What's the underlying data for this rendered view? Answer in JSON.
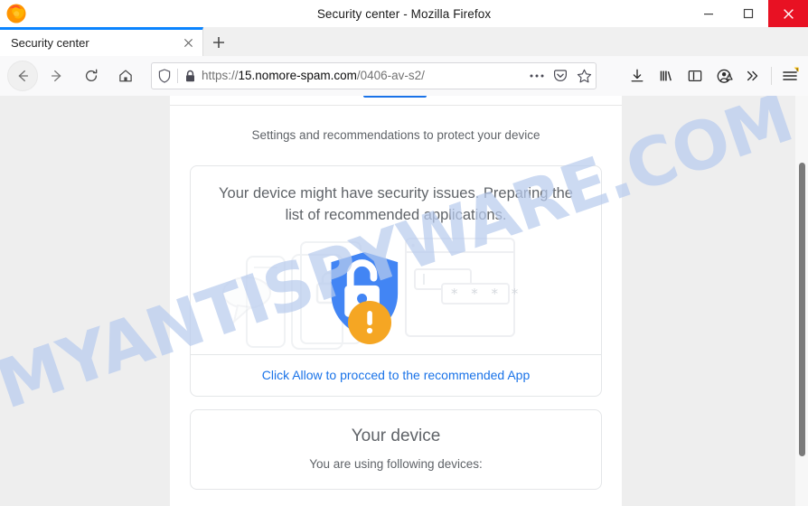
{
  "window": {
    "title": "Security center - Mozilla Firefox",
    "controls": {
      "minimize": "minimize",
      "maximize": "maximize",
      "close": "close"
    },
    "close_color": "#e81123"
  },
  "tabs": {
    "active": {
      "label": "Security center",
      "close_label": "x"
    },
    "new_tab_label": "+"
  },
  "toolbar": {
    "back_label": "back",
    "forward_label": "forward",
    "reload_label": "reload",
    "home_label": "home",
    "address": {
      "scheme": "https://",
      "host": "15.nomore-spam.com",
      "path": "/0406-av-s2/",
      "full": "https://15.nomore-spam.com/0406-av-s2/",
      "tracking_protection_icon": "shield-icon",
      "lock_icon": "padlock-icon",
      "page_actions_icon": "ellipsis-icon",
      "pocket_icon": "pocket-icon",
      "bookmark_icon": "star-icon"
    },
    "downloads_icon": "download-icon",
    "library_icon": "library-icon",
    "sidebar_icon": "sidebar-icon",
    "account_icon": "account-warning-icon",
    "overflow_icon": "double-chevron-icon",
    "menu_icon": "hamburger-menu-icon",
    "menu_badge_color": "#f5b800"
  },
  "page": {
    "subtitle": "Settings and recommendations to protect your device",
    "accent_color": "#1a73e8",
    "card": {
      "headline": "Your device might have security issues. Preparing the list of recommended applications.",
      "link": "Click Allow to procced to the recommended App",
      "illustration": {
        "shield_icon": "shield-lock-icon",
        "shield_color": "#4285f4",
        "warning_icon": "warning-exclamation-icon",
        "warning_color": "#f5a623",
        "password_mask": "* * * *"
      }
    },
    "card2": {
      "title": "Your device",
      "subtitle": "You are using following devices:"
    }
  },
  "watermark": {
    "text": "MYANTISPYWARE.COM",
    "color": "#b9ccee"
  }
}
